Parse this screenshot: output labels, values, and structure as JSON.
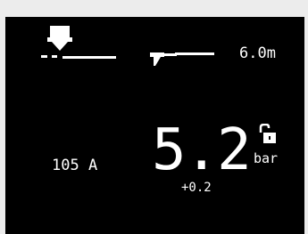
{
  "display": {
    "icons": {
      "torch": "welding-torch-icon",
      "hose": "hose-icon",
      "lock": "unlocked-padlock-icon"
    },
    "hose_length": "6.0m",
    "current": "105 A",
    "pressure": {
      "value": "5.2",
      "unit": "bar",
      "offset": "+0.2"
    },
    "colors": {
      "background": "#000000",
      "foreground": "#ffffff",
      "bezel": "#ececec"
    }
  }
}
